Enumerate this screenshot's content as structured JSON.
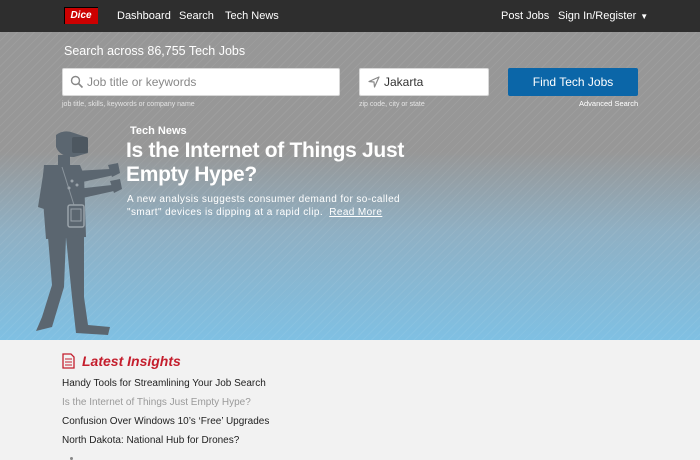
{
  "nav": {
    "logo": "Dice",
    "links": [
      "Dashboard",
      "Search",
      "Tech News"
    ],
    "right": {
      "post_jobs": "Post Jobs",
      "sign_in": "Sign In/Register"
    }
  },
  "search": {
    "heading": "Search across 86,755 Tech Jobs",
    "keywords_placeholder": "Job title or keywords",
    "keywords_hint": "job title, skills, keywords or company name",
    "location_value": "Jakarta",
    "location_hint": "zip code, city or state",
    "button": "Find Tech Jobs",
    "advanced": "Advanced Search"
  },
  "featured": {
    "category": "Tech News",
    "title": "Is the Internet of Things Just Empty Hype?",
    "body": "A new analysis suggests consumer demand for so-called \"smart\" devices is dipping at a rapid clip.",
    "read_more": "Read More"
  },
  "insights": {
    "title": "Latest Insights",
    "items": [
      "Handy Tools for Streamlining Your Job Search",
      "Is the Internet of Things Just Empty Hype?",
      "Confusion Over Windows 10’s ‘Free’ Upgrades",
      "North Dakota: National Hub for Drones?"
    ]
  },
  "colors": {
    "nav_bg": "#2e2e2e",
    "brand_red": "#cc0000",
    "button_blue": "#0b66a8",
    "insights_red": "#c41e2d"
  }
}
